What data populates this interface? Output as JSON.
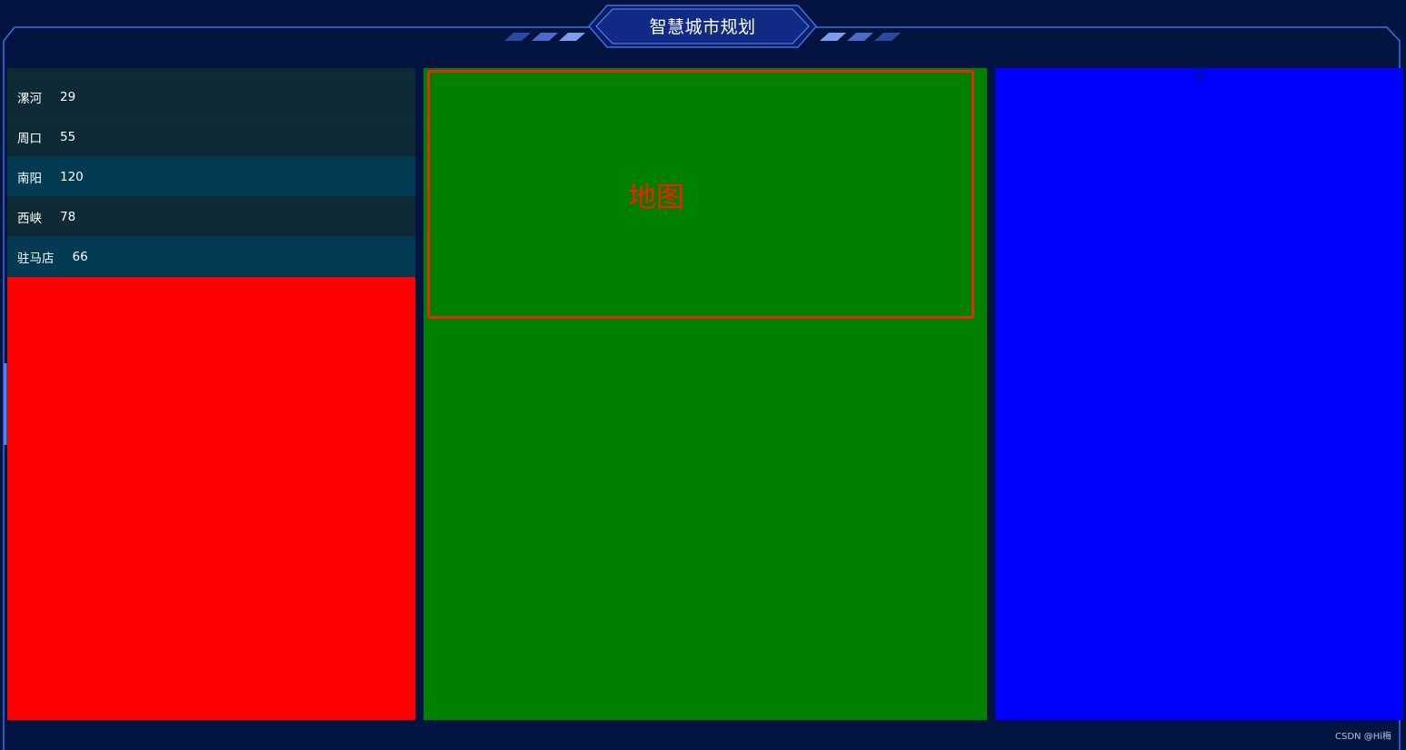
{
  "header": {
    "title": "智慧城市规划"
  },
  "left_panel": {
    "rows": [
      {
        "city": "",
        "value": ""
      },
      {
        "city": "漯河",
        "value": "29"
      },
      {
        "city": "周口",
        "value": "55"
      },
      {
        "city": "南阳",
        "value": "120"
      },
      {
        "city": "西峡",
        "value": "78"
      },
      {
        "city": "驻马店",
        "value": "66"
      }
    ]
  },
  "center_panel": {
    "map_label": "地图"
  },
  "right_panel": {
    "number": "3"
  },
  "footer": {
    "watermark": "CSDN @Hi梅"
  },
  "colors": {
    "background": "#031440",
    "frame": "#3f6fe0",
    "left_panel": "#ff0000",
    "center_panel": "#008000",
    "right_panel": "#0000ff",
    "map_border": "#e02b0f",
    "row_dark": "#0e2a35",
    "row_light": "#023a53"
  }
}
